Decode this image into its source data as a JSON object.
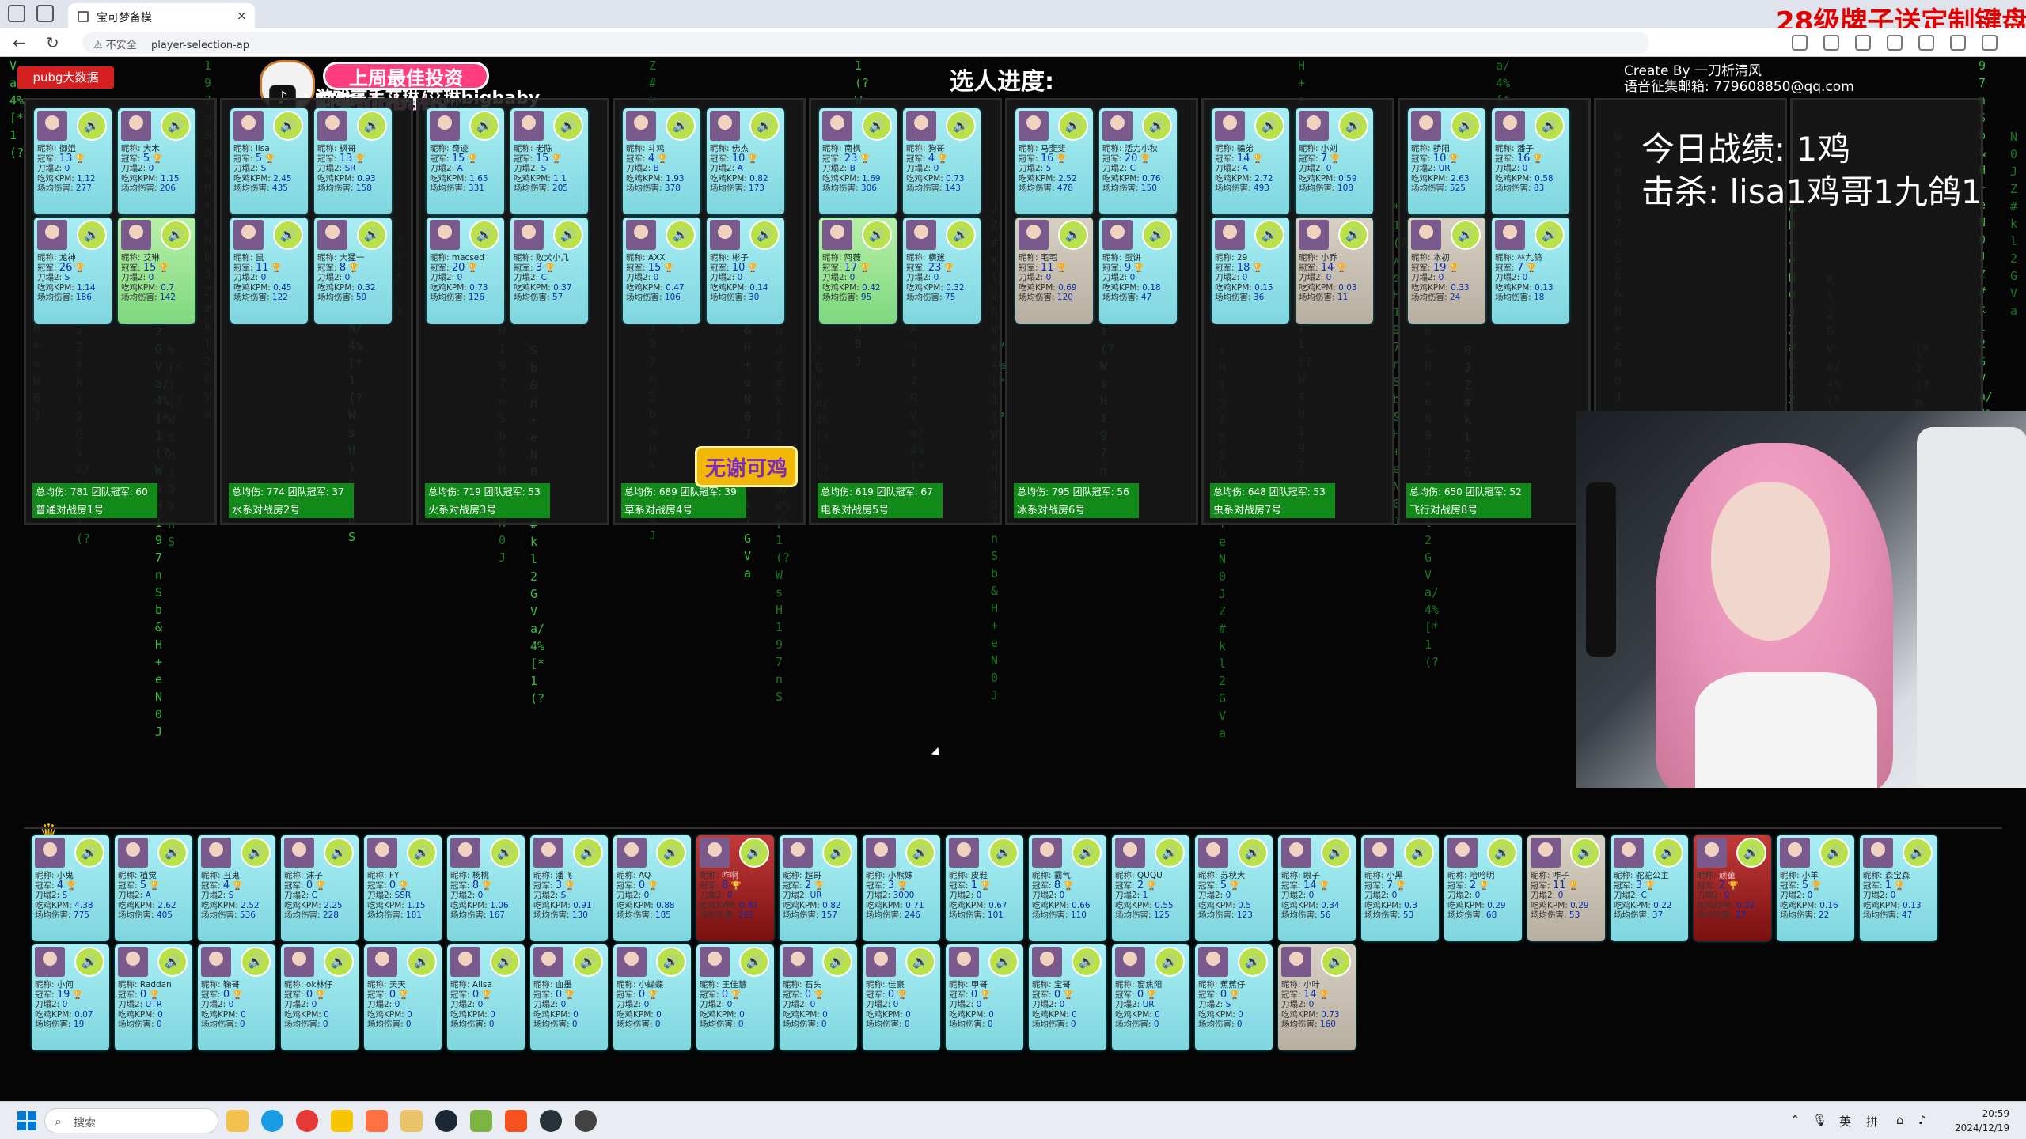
{
  "browser": {
    "tab_title": "宝可梦备模",
    "url_warning": "不安全",
    "url": "player-selection-ap",
    "promo_text": "28级牌子送定制键盘"
  },
  "header": {
    "pubg_button": "pubg大数据",
    "progress_title": "选人进度:",
    "create_by": "Create By 一刀析清风",
    "voice_email": "语音征集邮箱: 779608850@qq.com",
    "badge_top": "上周最佳投资",
    "badge_name": "阿柴bigbaby",
    "tiktok_line": ": 游戏高手艾琳/艾琳bigbaby",
    "today_record": "今日战绩: 1鸡",
    "kills": "击杀: lisa1鸡哥1九鸽1"
  },
  "merge_button": "无谢可鸡",
  "labels": {
    "nick": "昵称:",
    "crown": "冠军:",
    "knife": "刀塌2:",
    "kpm": "吃鸡KPM:",
    "dmg": "场均伤害:"
  },
  "rooms": [
    {
      "footer_stats": "总均伤: 781 团队冠军: 60",
      "name": "普通对战房1号",
      "players": [
        {
          "nick": "御姐",
          "crown": "13",
          "knife": "0",
          "kpm": "1.12",
          "dmg": "277"
        },
        {
          "nick": "大木",
          "crown": "5",
          "knife": "0",
          "kpm": "1.15",
          "dmg": "206"
        },
        {
          "nick": "龙神",
          "crown": "26",
          "knife": "S",
          "kpm": "1.14",
          "dmg": "186"
        },
        {
          "nick": "艾琳",
          "crown": "15",
          "knife": "0",
          "kpm": "0.7",
          "dmg": "142",
          "selected": true
        }
      ]
    },
    {
      "footer_stats": "总均伤: 774 团队冠军: 37",
      "name": "水系对战房2号",
      "players": [
        {
          "nick": "lisa",
          "crown": "5",
          "knife": "S",
          "kpm": "2.45",
          "dmg": "435"
        },
        {
          "nick": "枫哥",
          "crown": "13",
          "knife": "SR",
          "kpm": "0.93",
          "dmg": "158"
        },
        {
          "nick": "鼠",
          "crown": "11",
          "knife": "0",
          "kpm": "0.45",
          "dmg": "122"
        },
        {
          "nick": "大猛一",
          "crown": "8",
          "knife": "0",
          "kpm": "0.32",
          "dmg": "59"
        }
      ]
    },
    {
      "footer_stats": "总均伤: 719 团队冠军: 53",
      "name": "火系对战房3号",
      "players": [
        {
          "nick": "奇迹",
          "crown": "15",
          "knife": "A",
          "kpm": "1.65",
          "dmg": "331"
        },
        {
          "nick": "老陈",
          "crown": "15",
          "knife": "S",
          "kpm": "1.1",
          "dmg": "205"
        },
        {
          "nick": "macsed",
          "crown": "20",
          "knife": "0",
          "kpm": "0.73",
          "dmg": "126"
        },
        {
          "nick": "败犬小几",
          "crown": "3",
          "knife": "C",
          "kpm": "0.37",
          "dmg": "57"
        }
      ]
    },
    {
      "footer_stats": "总均伤: 689 团队冠军: 39",
      "name": "草系对战房4号",
      "players": [
        {
          "nick": "斗鸡",
          "crown": "4",
          "knife": "B",
          "kpm": "1.93",
          "dmg": "378"
        },
        {
          "nick": "佛杰",
          "crown": "10",
          "knife": "A",
          "kpm": "0.82",
          "dmg": "173"
        },
        {
          "nick": "AXX",
          "crown": "15",
          "knife": "0",
          "kpm": "0.47",
          "dmg": "106"
        },
        {
          "nick": "彬子",
          "crown": "10",
          "knife": "0",
          "kpm": "0.14",
          "dmg": "30"
        }
      ]
    },
    {
      "footer_stats": "总均伤: 619 团队冠军: 67",
      "name": "电系对战房5号",
      "players": [
        {
          "nick": "南枫",
          "crown": "23",
          "knife": "B",
          "kpm": "1.69",
          "dmg": "306"
        },
        {
          "nick": "狗哥",
          "crown": "4",
          "knife": "0",
          "kpm": "0.73",
          "dmg": "143"
        },
        {
          "nick": "阿薇",
          "crown": "17",
          "knife": "0",
          "kpm": "0.42",
          "dmg": "95",
          "selected": true
        },
        {
          "nick": "横迷",
          "crown": "23",
          "knife": "0",
          "kpm": "0.32",
          "dmg": "75"
        }
      ]
    },
    {
      "footer_stats": "总均伤: 795 团队冠军: 56",
      "name": "冰系对战房6号",
      "players": [
        {
          "nick": "马斐斐",
          "crown": "16",
          "knife": "5",
          "kpm": "2.52",
          "dmg": "478"
        },
        {
          "nick": "活力小秋",
          "crown": "20",
          "knife": "C",
          "kpm": "0.76",
          "dmg": "150"
        },
        {
          "nick": "宅宅",
          "crown": "11",
          "knife": "0",
          "kpm": "0.69",
          "dmg": "120",
          "gray": true
        },
        {
          "nick": "蛋饼",
          "crown": "9",
          "knife": "0",
          "kpm": "0.18",
          "dmg": "47"
        }
      ]
    },
    {
      "footer_stats": "总均伤: 648 团队冠军: 53",
      "name": "虫系对战房7号",
      "players": [
        {
          "nick": "骗弟",
          "crown": "14",
          "knife": "A",
          "kpm": "2.72",
          "dmg": "493"
        },
        {
          "nick": "小刘",
          "crown": "7",
          "knife": "0",
          "kpm": "0.59",
          "dmg": "108"
        },
        {
          "nick": "29",
          "crown": "18",
          "knife": "0",
          "kpm": "0.15",
          "dmg": "36"
        },
        {
          "nick": "小乔",
          "crown": "14",
          "knife": "0",
          "kpm": "0.03",
          "dmg": "11",
          "gray": true
        }
      ]
    },
    {
      "footer_stats": "总均伤: 650 团队冠军: 52",
      "name": "飞行对战房8号",
      "players": [
        {
          "nick": "骄阳",
          "crown": "10",
          "knife": "UR",
          "kpm": "2.63",
          "dmg": "525"
        },
        {
          "nick": "潘子",
          "crown": "16",
          "knife": "0",
          "kpm": "0.58",
          "dmg": "83"
        },
        {
          "nick": "本初",
          "crown": "19",
          "knife": "0",
          "kpm": "0.33",
          "dmg": "24",
          "gray": true
        },
        {
          "nick": "林九鸽",
          "crown": "7",
          "knife": "0",
          "kpm": "0.13",
          "dmg": "18"
        }
      ]
    }
  ],
  "pool": [
    {
      "nick": "小鬼",
      "crown": "4",
      "knife": "S",
      "kpm": "4.38",
      "dmg": "775"
    },
    {
      "nick": "植觉",
      "crown": "5",
      "knife": "A",
      "kpm": "2.62",
      "dmg": "405"
    },
    {
      "nick": "丑鬼",
      "crown": "4",
      "knife": "S",
      "kpm": "2.52",
      "dmg": "536"
    },
    {
      "nick": "沫子",
      "crown": "0",
      "knife": "C",
      "kpm": "2.25",
      "dmg": "228"
    },
    {
      "nick": "FY",
      "crown": "0",
      "knife": "SSR",
      "kpm": "1.15",
      "dmg": "181"
    },
    {
      "nick": "杨桃",
      "crown": "8",
      "knife": "0",
      "kpm": "1.06",
      "dmg": "167"
    },
    {
      "nick": "潘飞",
      "crown": "3",
      "knife": "S",
      "kpm": "0.91",
      "dmg": "130"
    },
    {
      "nick": "AQ",
      "crown": "0",
      "knife": "0",
      "kpm": "0.88",
      "dmg": "185"
    },
    {
      "nick": "咋啊",
      "crown": "8",
      "knife": "0",
      "kpm": "0.87",
      "dmg": "161",
      "red": true
    },
    {
      "nick": "超哥",
      "crown": "2",
      "knife": "UR",
      "kpm": "0.82",
      "dmg": "157"
    },
    {
      "nick": "小熊妹",
      "crown": "3",
      "knife": "3000",
      "kpm": "0.71",
      "dmg": "246"
    },
    {
      "nick": "皮鞋",
      "crown": "1",
      "knife": "0",
      "kpm": "0.67",
      "dmg": "101"
    },
    {
      "nick": "霸气",
      "crown": "8",
      "knife": "0",
      "kpm": "0.66",
      "dmg": "110"
    },
    {
      "nick": "QUQU",
      "crown": "2",
      "knife": "1",
      "kpm": "0.55",
      "dmg": "125"
    },
    {
      "nick": "苏秋大",
      "crown": "5",
      "knife": "0",
      "kpm": "0.5",
      "dmg": "123"
    },
    {
      "nick": "眼子",
      "crown": "14",
      "knife": "0",
      "kpm": "0.34",
      "dmg": "56"
    },
    {
      "nick": "小黑",
      "crown": "7",
      "knife": "0",
      "kpm": "0.3",
      "dmg": "53"
    },
    {
      "nick": "哈哈明",
      "crown": "2",
      "knife": "0",
      "kpm": "0.29",
      "dmg": "68"
    },
    {
      "nick": "咋子",
      "crown": "11",
      "knife": "0",
      "kpm": "0.29",
      "dmg": "53",
      "gray": true
    },
    {
      "nick": "驼驼公主",
      "crown": "3",
      "knife": "C",
      "kpm": "0.22",
      "dmg": "37"
    },
    {
      "nick": "顽童",
      "crown": "2",
      "knife": "0",
      "kpm": "0.22",
      "dmg": "27",
      "red": true
    },
    {
      "nick": "小羊",
      "crown": "5",
      "knife": "0",
      "kpm": "0.16",
      "dmg": "22"
    },
    {
      "nick": "森宝森",
      "crown": "1",
      "knife": "0",
      "kpm": "0.13",
      "dmg": "47"
    },
    {
      "nick": "小何",
      "crown": "19",
      "knife": "0",
      "kpm": "0.07",
      "dmg": "19"
    },
    {
      "nick": "Raddan",
      "crown": "0",
      "knife": "UTR",
      "kpm": "0",
      "dmg": "0"
    },
    {
      "nick": "鞠哥",
      "crown": "0",
      "knife": "0",
      "kpm": "0",
      "dmg": "0"
    },
    {
      "nick": "ok林仔",
      "crown": "0",
      "knife": "0",
      "kpm": "0",
      "dmg": "0"
    },
    {
      "nick": "天天",
      "crown": "0",
      "knife": "0",
      "kpm": "0",
      "dmg": "0"
    },
    {
      "nick": "Alisa",
      "crown": "0",
      "knife": "0",
      "kpm": "0",
      "dmg": "0"
    },
    {
      "nick": "血墨",
      "crown": "0",
      "knife": "0",
      "kpm": "0",
      "dmg": "0"
    },
    {
      "nick": "小蝴蝶",
      "crown": "0",
      "knife": "0",
      "kpm": "0",
      "dmg": "0"
    },
    {
      "nick": "王佳慧",
      "crown": "0",
      "knife": "0",
      "kpm": "0",
      "dmg": "0"
    },
    {
      "nick": "石头",
      "crown": "0",
      "knife": "0",
      "kpm": "0",
      "dmg": "0"
    },
    {
      "nick": "佳豪",
      "crown": "0",
      "knife": "0",
      "kpm": "0",
      "dmg": "0"
    },
    {
      "nick": "甲哥",
      "crown": "0",
      "knife": "0",
      "kpm": "0",
      "dmg": "0"
    },
    {
      "nick": "宝哥",
      "crown": "0",
      "knife": "0",
      "kpm": "0",
      "dmg": "0"
    },
    {
      "nick": "窗焦阳",
      "crown": "0",
      "knife": "UR",
      "kpm": "0",
      "dmg": "0"
    },
    {
      "nick": "蕉蕉仔",
      "crown": "0",
      "knife": "S",
      "kpm": "0",
      "dmg": "0"
    },
    {
      "nick": "小叶",
      "crown": "14",
      "knife": "0",
      "kpm": "0.73",
      "dmg": "160",
      "gray": true
    }
  ],
  "taskbar": {
    "search": "搜索",
    "time": "20:59",
    "date": "2024/12/19",
    "ime1": "英",
    "ime2": "拼"
  }
}
